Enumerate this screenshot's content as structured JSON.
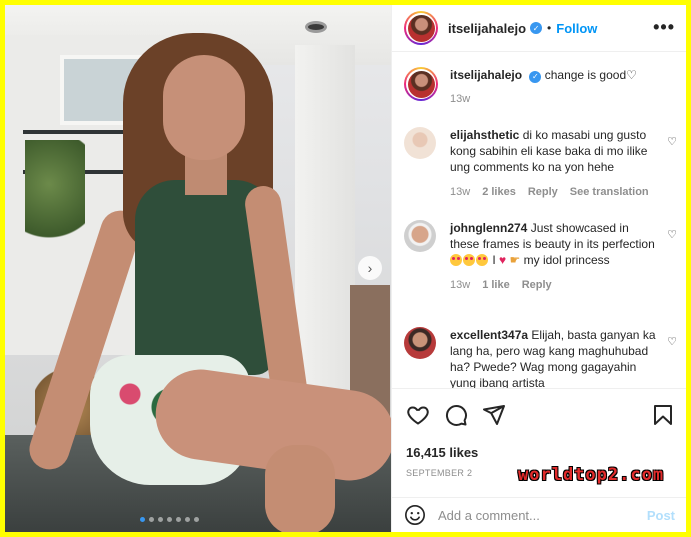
{
  "header": {
    "username": "itselijahalejo",
    "separator": "•",
    "follow_label": "Follow",
    "more_icon": "more-horizontal-icon"
  },
  "caption": {
    "username": "itselijahalejo",
    "text": "change is good♡",
    "time": "13w"
  },
  "comments": [
    {
      "username": "elijahsthetic",
      "text": "di ko masabi ung gusto kong sabihin eli kase baka di mo ilike ung comments ko na yon hehe",
      "time": "13w",
      "likes": "2 likes",
      "reply": "Reply",
      "translate": "See translation"
    },
    {
      "username": "johnglenn274",
      "text_a": "Just showcased in these frames is beauty in its perfection",
      "text_b": "I",
      "text_c": "my idol princess",
      "time": "13w",
      "likes": "1 like",
      "reply": "Reply"
    },
    {
      "username": "excellent347a",
      "text": "Elijah, basta ganyan ka lang ha, pero wag kang maghuhubad ha? Pwede? Wag mong gagayahin yung ibang artista"
    }
  ],
  "post": {
    "likes": "16,415 likes",
    "date": "SEPTEMBER 2",
    "watermark": "worldtop2.com"
  },
  "add_comment": {
    "placeholder": "Add a comment...",
    "post_label": "Post"
  },
  "carousel": {
    "slide_count": 7,
    "active_index": 0
  },
  "colors": {
    "accent": "#0095f6",
    "verified": "#3897f0",
    "border": "#ffff00"
  }
}
